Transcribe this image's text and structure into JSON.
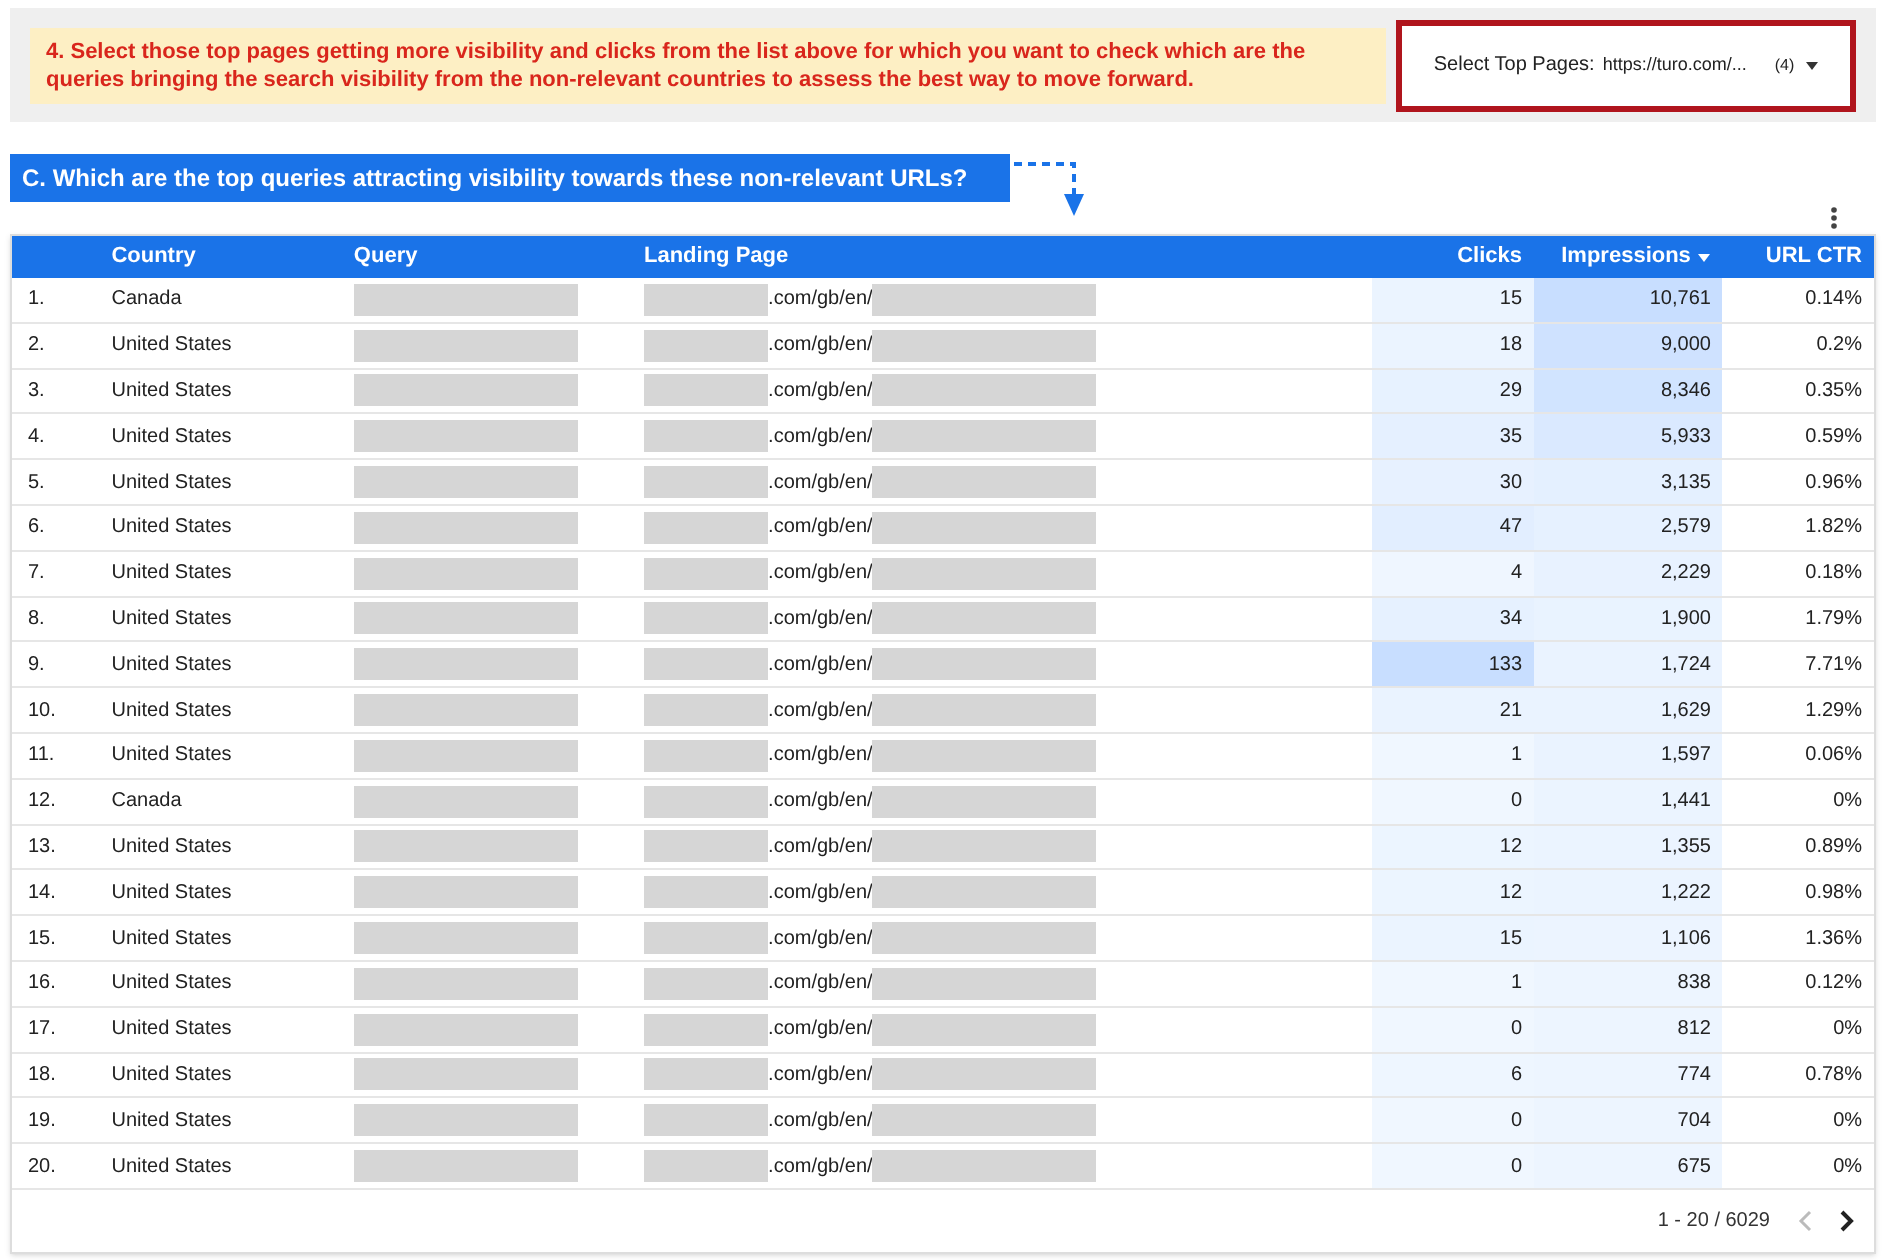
{
  "instruction": "4. Select those top pages getting more visibility and clicks from the list above for which you want to check which are the queries bringing the search visibility from the non-relevant countries to assess the best way to move forward.",
  "filter": {
    "label": "Select Top Pages:",
    "value": "https://turo.com/...",
    "count": "(4)"
  },
  "section_title": "C. Which are the top queries attracting visibility towards these non-relevant URLs?",
  "table": {
    "columns": [
      {
        "label": "Country",
        "sorted": false
      },
      {
        "label": "Query",
        "sorted": false
      },
      {
        "label": "Landing Page",
        "sorted": false
      },
      {
        "label": "Clicks",
        "sorted": false
      },
      {
        "label": "Impressions",
        "sorted": true
      },
      {
        "label": "URL CTR",
        "sorted": false
      }
    ],
    "rows": [
      {
        "index": "1.",
        "country": "Canada",
        "landing": ".com/gb/en/",
        "clicks": "15",
        "impressions": "10,761",
        "ctr": "0.14%"
      },
      {
        "index": "2.",
        "country": "United States",
        "landing": ".com/gb/en/",
        "clicks": "18",
        "impressions": "9,000",
        "ctr": "0.2%"
      },
      {
        "index": "3.",
        "country": "United States",
        "landing": ".com/gb/en/",
        "clicks": "29",
        "impressions": "8,346",
        "ctr": "0.35%"
      },
      {
        "index": "4.",
        "country": "United States",
        "landing": ".com/gb/en/",
        "clicks": "35",
        "impressions": "5,933",
        "ctr": "0.59%"
      },
      {
        "index": "5.",
        "country": "United States",
        "landing": ".com/gb/en/",
        "clicks": "30",
        "impressions": "3,135",
        "ctr": "0.96%"
      },
      {
        "index": "6.",
        "country": "United States",
        "landing": ".com/gb/en/",
        "clicks": "47",
        "impressions": "2,579",
        "ctr": "1.82%"
      },
      {
        "index": "7.",
        "country": "United States",
        "landing": ".com/gb/en/",
        "clicks": "4",
        "impressions": "2,229",
        "ctr": "0.18%"
      },
      {
        "index": "8.",
        "country": "United States",
        "landing": ".com/gb/en/",
        "clicks": "34",
        "impressions": "1,900",
        "ctr": "1.79%"
      },
      {
        "index": "9.",
        "country": "United States",
        "landing": ".com/gb/en/",
        "clicks": "133",
        "impressions": "1,724",
        "ctr": "7.71%"
      },
      {
        "index": "10.",
        "country": "United States",
        "landing": ".com/gb/en/",
        "clicks": "21",
        "impressions": "1,629",
        "ctr": "1.29%"
      },
      {
        "index": "11.",
        "country": "United States",
        "landing": ".com/gb/en/",
        "clicks": "1",
        "impressions": "1,597",
        "ctr": "0.06%"
      },
      {
        "index": "12.",
        "country": "Canada",
        "landing": ".com/gb/en/",
        "clicks": "0",
        "impressions": "1,441",
        "ctr": "0%"
      },
      {
        "index": "13.",
        "country": "United States",
        "landing": ".com/gb/en/",
        "clicks": "12",
        "impressions": "1,355",
        "ctr": "0.89%"
      },
      {
        "index": "14.",
        "country": "United States",
        "landing": ".com/gb/en/",
        "clicks": "12",
        "impressions": "1,222",
        "ctr": "0.98%"
      },
      {
        "index": "15.",
        "country": "United States",
        "landing": ".com/gb/en/",
        "clicks": "15",
        "impressions": "1,106",
        "ctr": "1.36%"
      },
      {
        "index": "16.",
        "country": "United States",
        "landing": ".com/gb/en/",
        "clicks": "1",
        "impressions": "838",
        "ctr": "0.12%"
      },
      {
        "index": "17.",
        "country": "United States",
        "landing": ".com/gb/en/",
        "clicks": "0",
        "impressions": "812",
        "ctr": "0%"
      },
      {
        "index": "18.",
        "country": "United States",
        "landing": ".com/gb/en/",
        "clicks": "6",
        "impressions": "774",
        "ctr": "0.78%"
      },
      {
        "index": "19.",
        "country": "United States",
        "landing": ".com/gb/en/",
        "clicks": "0",
        "impressions": "704",
        "ctr": "0%"
      },
      {
        "index": "20.",
        "country": "United States",
        "landing": ".com/gb/en/",
        "clicks": "0",
        "impressions": "675",
        "ctr": "0%"
      }
    ]
  },
  "pagination": {
    "range": "1 - 20 / 6029",
    "prev_disabled": true
  }
}
